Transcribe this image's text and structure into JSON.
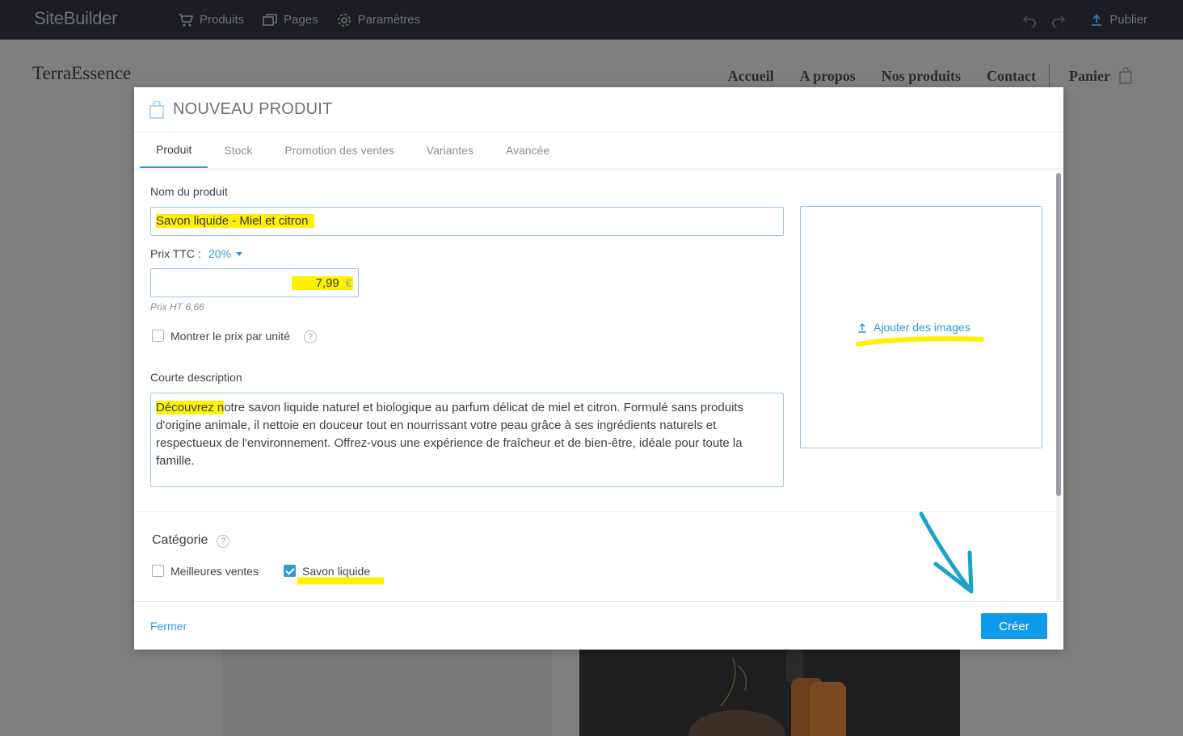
{
  "builder": {
    "brand": "SiteBuilder",
    "nav": [
      {
        "label": "Produits",
        "icon": "cart-icon"
      },
      {
        "label": "Pages",
        "icon": "pages-icon"
      },
      {
        "label": "Paramètres",
        "icon": "gear-icon"
      }
    ],
    "publish_label": "Publier"
  },
  "site": {
    "logo": "TerraEssence",
    "nav": [
      "Accueil",
      "A propos",
      "Nos produits",
      "Contact"
    ],
    "cart_label": "Panier"
  },
  "modal": {
    "title": "NOUVEAU PRODUIT",
    "tabs": [
      "Produit",
      "Stock",
      "Promotion des ventes",
      "Variantes",
      "Avancée"
    ],
    "active_tab": "Produit",
    "name_label": "Nom du produit",
    "name_value": "Savon liquide - Miel et citron",
    "price_label": "Prix TTC :",
    "vat_rate": "20%",
    "price_value": "7,99",
    "currency": "€",
    "price_ht": "Prix HT 6,66",
    "unit_price_label": "Montrer le prix par unité",
    "unit_price_checked": false,
    "desc_label": "Courte description",
    "desc_highlight": "Découvrez n",
    "desc_rest": "otre savon liquide naturel et biologique au parfum délicat de miel et citron. Formulé sans produits d'origine animale, il nettoie en douceur tout en nourrissant votre peau grâce à ses ingrédients naturels et respectueux de l'environnement. Offrez-vous une expérience de fraîcheur et de bien-être, idéale pour toute la famille.",
    "add_images_label": "Ajouter des images",
    "category_title": "Catégorie",
    "categories": [
      {
        "label": "Meilleures ventes",
        "checked": false
      },
      {
        "label": "Savon liquide",
        "checked": true
      }
    ],
    "close_label": "Fermer",
    "create_label": "Créer"
  },
  "colors": {
    "accent": "#0d9ae8",
    "highlight": "#fff100",
    "annotation_arrow": "#1aa3c9",
    "topbar": "#1b1d22"
  }
}
